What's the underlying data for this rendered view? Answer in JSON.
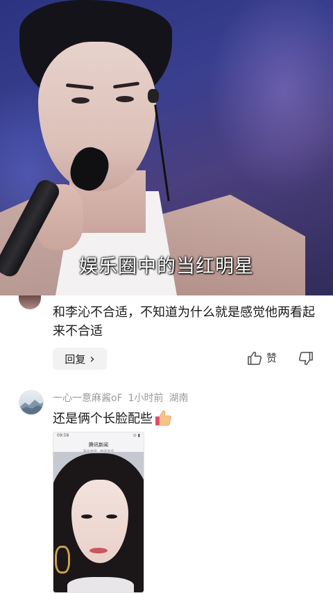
{
  "video": {
    "subtitle": "娱乐圈中的当红明星"
  },
  "comment1": {
    "text": "和李沁不合适，不知道为什么就是感觉他两看起来不合适",
    "reply_label": "回复",
    "reply_chevron": "›",
    "like_label": "赞",
    "like_icon": "thumbs-up-icon",
    "dislike_icon": "thumbs-down-icon"
  },
  "comment2": {
    "username": "一心一意麻酱oF",
    "time": "1小时前",
    "location": "湖南",
    "text": "还是俩个长脸配些",
    "emoji": "thumbs-up-emoji",
    "attachment": {
      "status_time": "09:58",
      "status_right": "⊙ ▮",
      "app_title": "腾讯新闻",
      "app_sub": "事实真相 · 新闻资讯"
    }
  },
  "colors": {
    "text": "#1a1a1a",
    "meta": "#9a9a9a",
    "reply_bg": "#f2f2f2"
  }
}
